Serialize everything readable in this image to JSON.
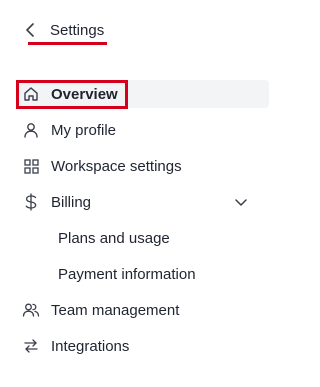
{
  "header": {
    "back_title": "Settings"
  },
  "nav": {
    "items": [
      {
        "label": "Overview",
        "icon": "home-icon",
        "active": true
      },
      {
        "label": "My profile",
        "icon": "user-icon"
      },
      {
        "label": "Workspace settings",
        "icon": "grid-icon"
      },
      {
        "label": "Billing",
        "icon": "dollar-icon",
        "expanded": true,
        "children": [
          "Plans and usage",
          "Payment information"
        ]
      },
      {
        "label": "Team management",
        "icon": "users-icon"
      },
      {
        "label": "Integrations",
        "icon": "arrows-swap-icon"
      }
    ]
  },
  "colors": {
    "annotation_red": "#d6001c",
    "active_bg": "#f3f4f6",
    "text": "#1f2430",
    "icon": "#3a3f4b"
  }
}
